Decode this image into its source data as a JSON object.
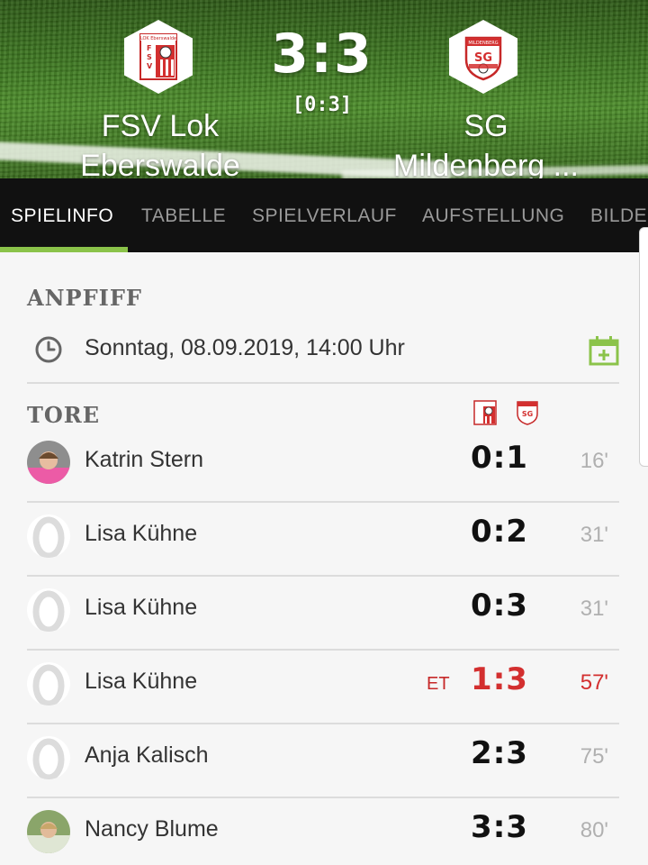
{
  "match": {
    "home_team": "FSV Lok\nEberswalde",
    "away_team": "SG\nMildenberg ...",
    "score": "3:3",
    "halftime": "[0:3]"
  },
  "tabs": [
    "SPIELINFO",
    "TABELLE",
    "SPIELVERLAUF",
    "AUFSTELLUNG",
    "BILDE"
  ],
  "active_tab": 0,
  "kickoff": {
    "heading": "ANPFIFF",
    "datetime": "Sonntag, 08.09.2019, 14:00 Uhr"
  },
  "goals_heading": "TORE",
  "goals": [
    {
      "player": "Katrin Stern",
      "score": "0:1",
      "minute": "16'",
      "own_goal": "",
      "highlight": false,
      "avatar": "photo"
    },
    {
      "player": "Lisa Kühne",
      "score": "0:2",
      "minute": "31'",
      "own_goal": "",
      "highlight": false,
      "avatar": "blank"
    },
    {
      "player": "Lisa Kühne",
      "score": "0:3",
      "minute": "31'",
      "own_goal": "",
      "highlight": false,
      "avatar": "blank"
    },
    {
      "player": "Lisa Kühne",
      "score": "1:3",
      "minute": "57'",
      "own_goal": "ET",
      "highlight": true,
      "avatar": "blank"
    },
    {
      "player": "Anja Kalisch",
      "score": "2:3",
      "minute": "75'",
      "own_goal": "",
      "highlight": false,
      "avatar": "blank"
    },
    {
      "player": "Nancy Blume",
      "score": "3:3",
      "minute": "80'",
      "own_goal": "",
      "highlight": false,
      "avatar": "photo"
    }
  ],
  "colors": {
    "accent_green": "#8bc34a",
    "own_goal_red": "#d32f2f",
    "tab_bar": "#111111"
  }
}
